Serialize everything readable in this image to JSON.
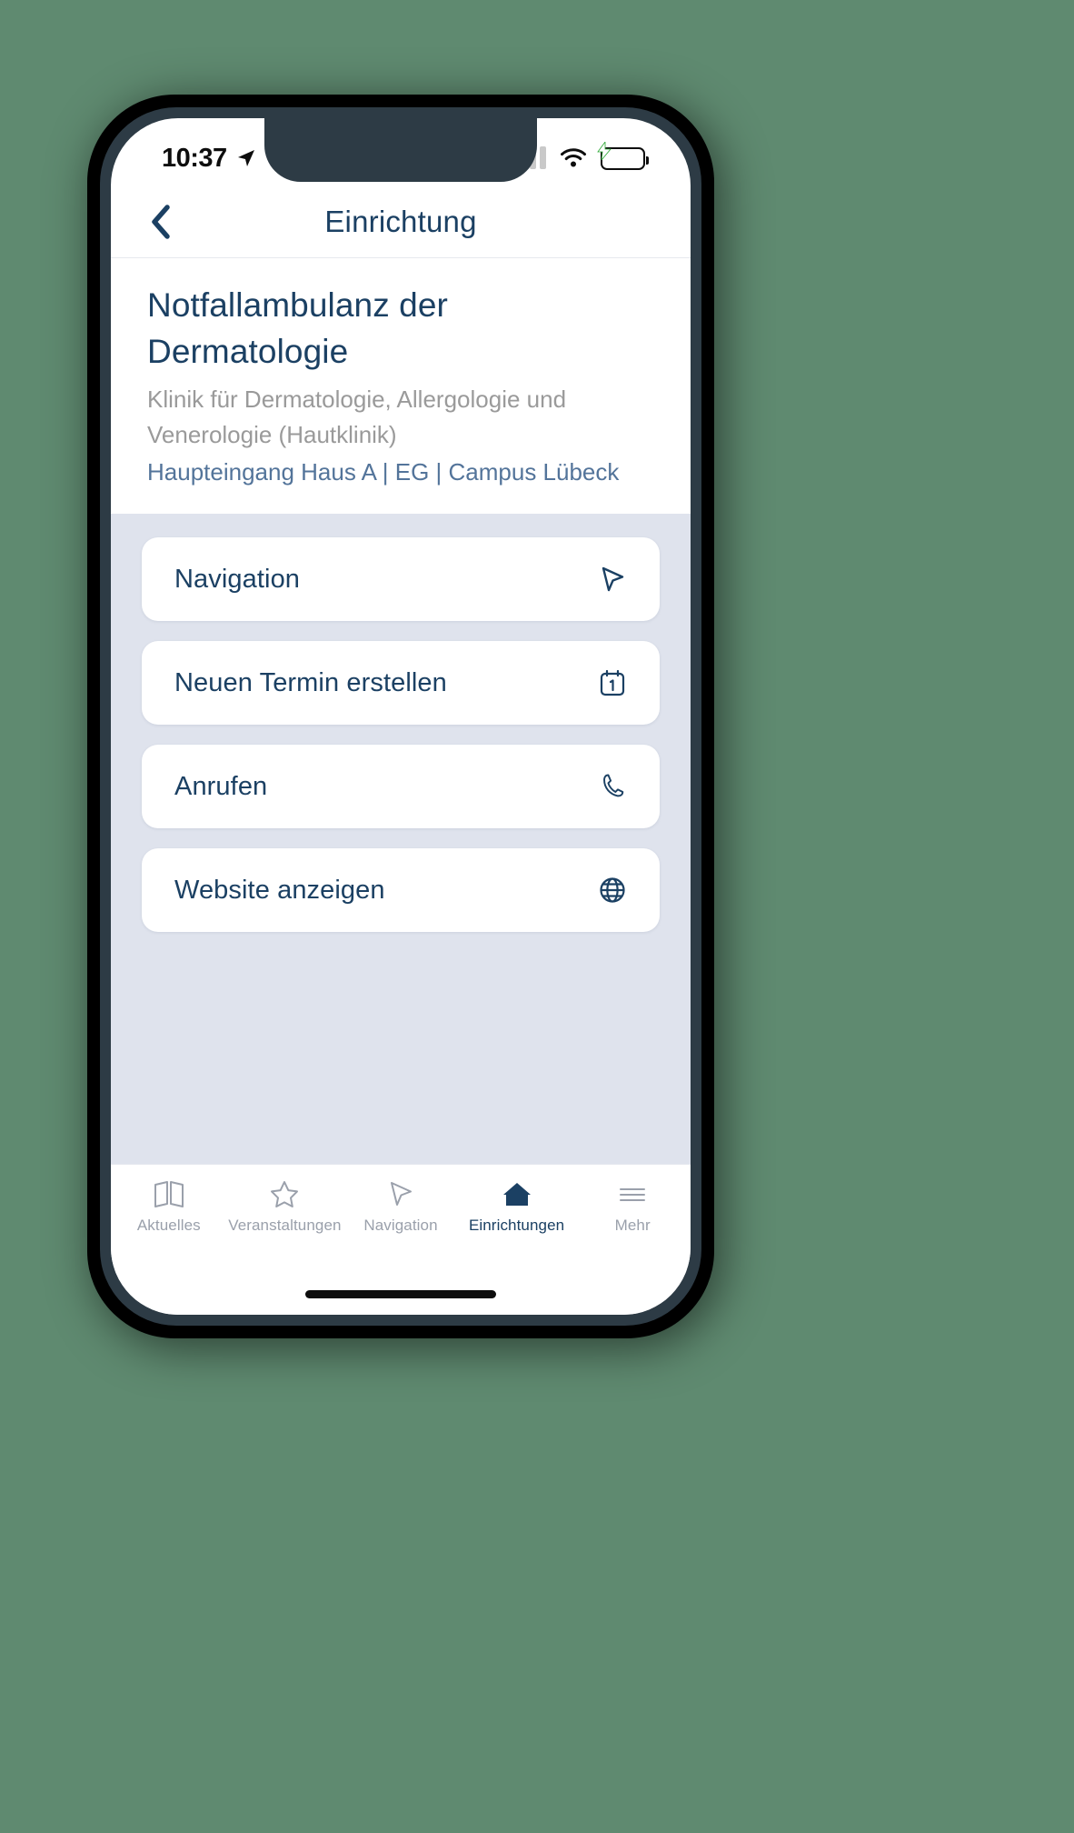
{
  "status_bar": {
    "time": "10:37",
    "location_icon": "location-arrow-icon",
    "signal_icon": "cellular-signal-icon",
    "wifi_icon": "wifi-icon",
    "battery_icon": "battery-charging-icon",
    "battery_color": "#3ad545"
  },
  "navbar": {
    "back_icon": "chevron-left-icon",
    "title": "Einrichtung"
  },
  "header": {
    "title": "Notfallambulanz der Dermatologie",
    "subtitle": "Klinik für Dermatologie, Allergologie und Venerologie (Hautklinik)",
    "location": "Haupteingang Haus A | EG | Campus Lübeck"
  },
  "actions": [
    {
      "label": "Navigation",
      "icon": "cursor-arrow-icon"
    },
    {
      "label": "Neuen Termin erstellen",
      "icon": "calendar-icon"
    },
    {
      "label": "Anrufen",
      "icon": "phone-icon"
    },
    {
      "label": "Website anzeigen",
      "icon": "globe-icon"
    }
  ],
  "tabbar": {
    "items": [
      {
        "label": "Aktuelles",
        "icon": "book-open-icon",
        "active": false
      },
      {
        "label": "Veranstaltungen",
        "icon": "star-icon",
        "active": false
      },
      {
        "label": "Navigation",
        "icon": "cursor-arrow-icon",
        "active": false
      },
      {
        "label": "Einrichtungen",
        "icon": "house-icon",
        "active": true
      },
      {
        "label": "Mehr",
        "icon": "hamburger-menu-icon",
        "active": false
      }
    ]
  },
  "colors": {
    "accent": "#1b4063",
    "muted_blue": "#53749a",
    "gray_text": "#9a9a9a",
    "background": "#dfe3ed"
  }
}
